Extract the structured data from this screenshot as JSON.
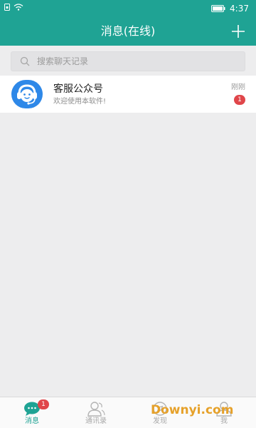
{
  "status_bar": {
    "time": "4:37"
  },
  "header": {
    "title": "消息(在线)",
    "add_icon": "plus-icon"
  },
  "search": {
    "placeholder": "搜索聊天记录",
    "value": ""
  },
  "chats": [
    {
      "name": "客服公众号",
      "preview": "欢迎使用本软件!",
      "time": "刚刚",
      "unread": "1",
      "avatar_icon": "customer-service-avatar-icon"
    }
  ],
  "nav": {
    "items": [
      {
        "label": "消息",
        "badge": "1",
        "icon": "chat-bubble-icon",
        "active": true
      },
      {
        "label": "通讯录",
        "icon": "contacts-icon",
        "active": false
      },
      {
        "label": "发现",
        "icon": "discover-icon",
        "active": false
      },
      {
        "label": "我",
        "icon": "profile-icon",
        "active": false
      }
    ]
  },
  "watermark": "Downyi.com",
  "colors": {
    "accent": "#1fa394",
    "badge": "#e0464a",
    "avatar": "#2e88e8"
  }
}
